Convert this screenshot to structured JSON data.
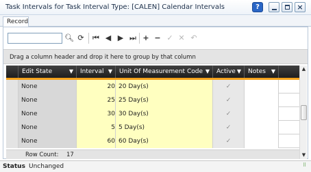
{
  "window": {
    "title": "Task Intervals for Task Interval Type: [CALEN] Calendar Intervals",
    "help_icon": "help-icon",
    "buttons": [
      "minimize-icon",
      "maximize-icon",
      "close-icon"
    ]
  },
  "tabs": [
    {
      "label": "Record",
      "active": true
    }
  ],
  "toolbar": {
    "search_value": "",
    "icons": [
      "search-icon",
      "refresh-icon",
      "first-record-icon",
      "previous-record-icon",
      "next-record-icon",
      "last-record-icon",
      "add-icon",
      "delete-icon",
      "save-icon",
      "cancel-icon",
      "undo-icon"
    ]
  },
  "group_panel": {
    "text": "Drag a column header and drop it here to group by that column"
  },
  "grid": {
    "columns": [
      "Edit State",
      "Interval",
      "Unit Of Measurement Code",
      "Active",
      "Notes"
    ],
    "rows": [
      {
        "edit_state": "None",
        "interval": "20",
        "uom": "20 Day(s)",
        "active": "✓",
        "notes": ""
      },
      {
        "edit_state": "None",
        "interval": "25",
        "uom": "25 Day(s)",
        "active": "✓",
        "notes": ""
      },
      {
        "edit_state": "None",
        "interval": "30",
        "uom": "30 Day(s)",
        "active": "✓",
        "notes": ""
      },
      {
        "edit_state": "None",
        "interval": "5",
        "uom": "5 Day(s)",
        "active": "✓",
        "notes": ""
      },
      {
        "edit_state": "None",
        "interval": "60",
        "uom": "60 Day(s)",
        "active": "✓",
        "notes": ""
      }
    ],
    "footer": {
      "row_count_label": "Row Count:",
      "row_count": "17"
    }
  },
  "status": {
    "label": "Status",
    "value": "Unchanged"
  },
  "colors": {
    "header_bg": "#2b2b2b",
    "accent_orange": "#f4a21c",
    "editable_cell": "#ffffc0",
    "help_blue": "#2a66c6"
  }
}
